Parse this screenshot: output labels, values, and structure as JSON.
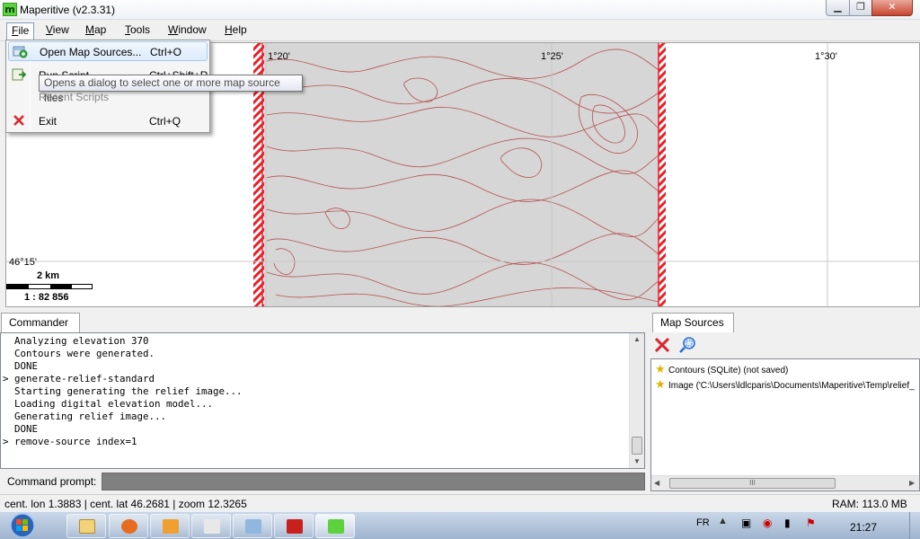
{
  "window": {
    "title": "Maperitive (v2.3.31)",
    "app_icon_letter": "m",
    "min_glyph": "▁",
    "max_glyph": "❐",
    "close_glyph": "✕"
  },
  "menubar": {
    "items": [
      "File",
      "View",
      "Map",
      "Tools",
      "Window",
      "Help"
    ],
    "underline": [
      "F",
      "V",
      "M",
      "T",
      "W",
      "H"
    ]
  },
  "file_menu": {
    "open_label": "Open Map Sources...",
    "open_shortcut": "Ctrl+O",
    "run_label": "Run Script...",
    "run_shortcut": "Ctrl+Shift+R",
    "recent_label": "Recent Scripts",
    "exit_label": "Exit",
    "exit_shortcut": "Ctrl+Q",
    "tooltip": "Opens a dialog to select one or more map source files"
  },
  "map": {
    "lon_labels": [
      "1°20'",
      "1°25'",
      "1°30'"
    ],
    "lat_label": "46°15'",
    "scale_distance": "2 km",
    "scale_ratio": "1 : 82 856"
  },
  "commander": {
    "tab_label": "Commander",
    "lines": [
      "  Analyzing elevation 370",
      "  Contours were generated.",
      "  DONE",
      "> generate-relief-standard",
      "  Starting generating the relief image...",
      "  Loading digital elevation model...",
      "  Generating relief image...",
      "  DONE",
      "> remove-source index=1"
    ],
    "prompt_label": "Command prompt:",
    "prompt_value": ""
  },
  "map_sources": {
    "tab_label": "Map Sources",
    "items": [
      "Contours (SQLite) (not saved)",
      "Image ('C:\\Users\\ldlcparis\\Documents\\Maperitive\\Temp\\relief_"
    ],
    "scroll_grip": "III"
  },
  "statusbar": {
    "position": "cent. lon 1.3883 | cent. lat 46.2681 | zoom 12.3265",
    "ram": "RAM: 113.0 MB"
  },
  "taskbar": {
    "language": "FR",
    "clock": "21:27"
  },
  "colors": {
    "accent": "#3399ff",
    "contour": "#b03a3a",
    "boundary": "#e8202a",
    "relief": "#d4d4d4"
  }
}
